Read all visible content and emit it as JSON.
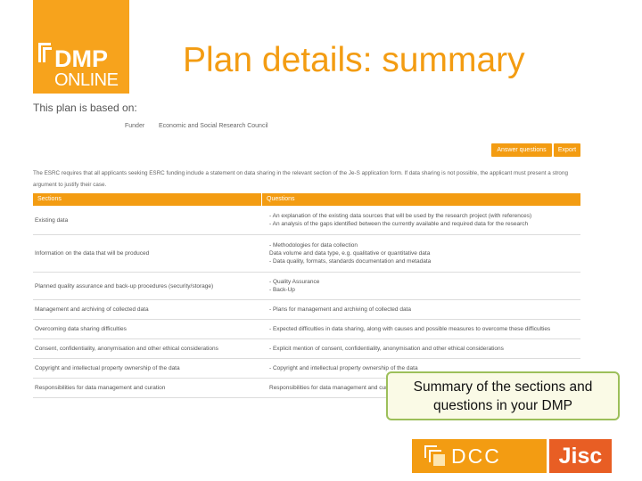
{
  "logo": {
    "dmp": "DMP",
    "online": "ONLINE"
  },
  "title": "Plan details: summary",
  "based_on": "This plan is based on:",
  "funder": {
    "label": "Funder",
    "value": "Economic and Social Research Council"
  },
  "buttons": {
    "answer": "Answer questions",
    "export": "Export"
  },
  "note": "The ESRC requires that all applicants seeking ESRC funding include a statement on data sharing in the relevant section of the Je-S application form. If data sharing is not possible, the applicant must present a strong argument to justify their case.",
  "table": {
    "headers": {
      "sections": "Sections",
      "questions": "Questions"
    },
    "rows": [
      {
        "section": "Existing data",
        "questions": [
          "- An explanation of the existing data sources that will be used by the research project (with references)",
          "- An analysis of the gaps identified between the currently available and required data for the research"
        ]
      },
      {
        "section": "Information on the data that will be produced",
        "questions": [
          "- Methodologies for data collection",
          "  Data volume and data type, e.g. qualitative or quantitative data",
          "- Data quality, formats, standards documentation and metadata"
        ]
      },
      {
        "section": "Planned quality assurance and back-up procedures (security/storage)",
        "questions": [
          "- Quality Assurance",
          "- Back-Up"
        ]
      },
      {
        "section": "Management and archiving of collected data",
        "questions": [
          "- Plans for management and archiving of collected data"
        ]
      },
      {
        "section": "Overcoming data sharing difficulties",
        "questions": [
          "- Expected difficulties in data sharing, along with causes and possible measures to overcome these difficulties"
        ]
      },
      {
        "section": "Consent, confidentiality, anonymisation and other ethical considerations",
        "questions": [
          "- Explicit mention of consent, confidentiality, anonymisation and other ethical considerations"
        ]
      },
      {
        "section": "Copyright and intellectual property ownership of the data",
        "questions": [
          "- Copyright and intellectual property ownership of the data"
        ]
      },
      {
        "section": "Responsibilities for data management and curation",
        "questions": [
          "Responsibilities for data management and curation"
        ]
      }
    ]
  },
  "callout": "Summary of the sections and questions in your DMP",
  "footer": {
    "dcc": "DCC",
    "jisc": "Jisc"
  },
  "colors": {
    "accent": "#f39c12",
    "logo_orange": "#f7a31c",
    "jisc": "#e85e24",
    "callout_border": "#9cbf5a"
  }
}
